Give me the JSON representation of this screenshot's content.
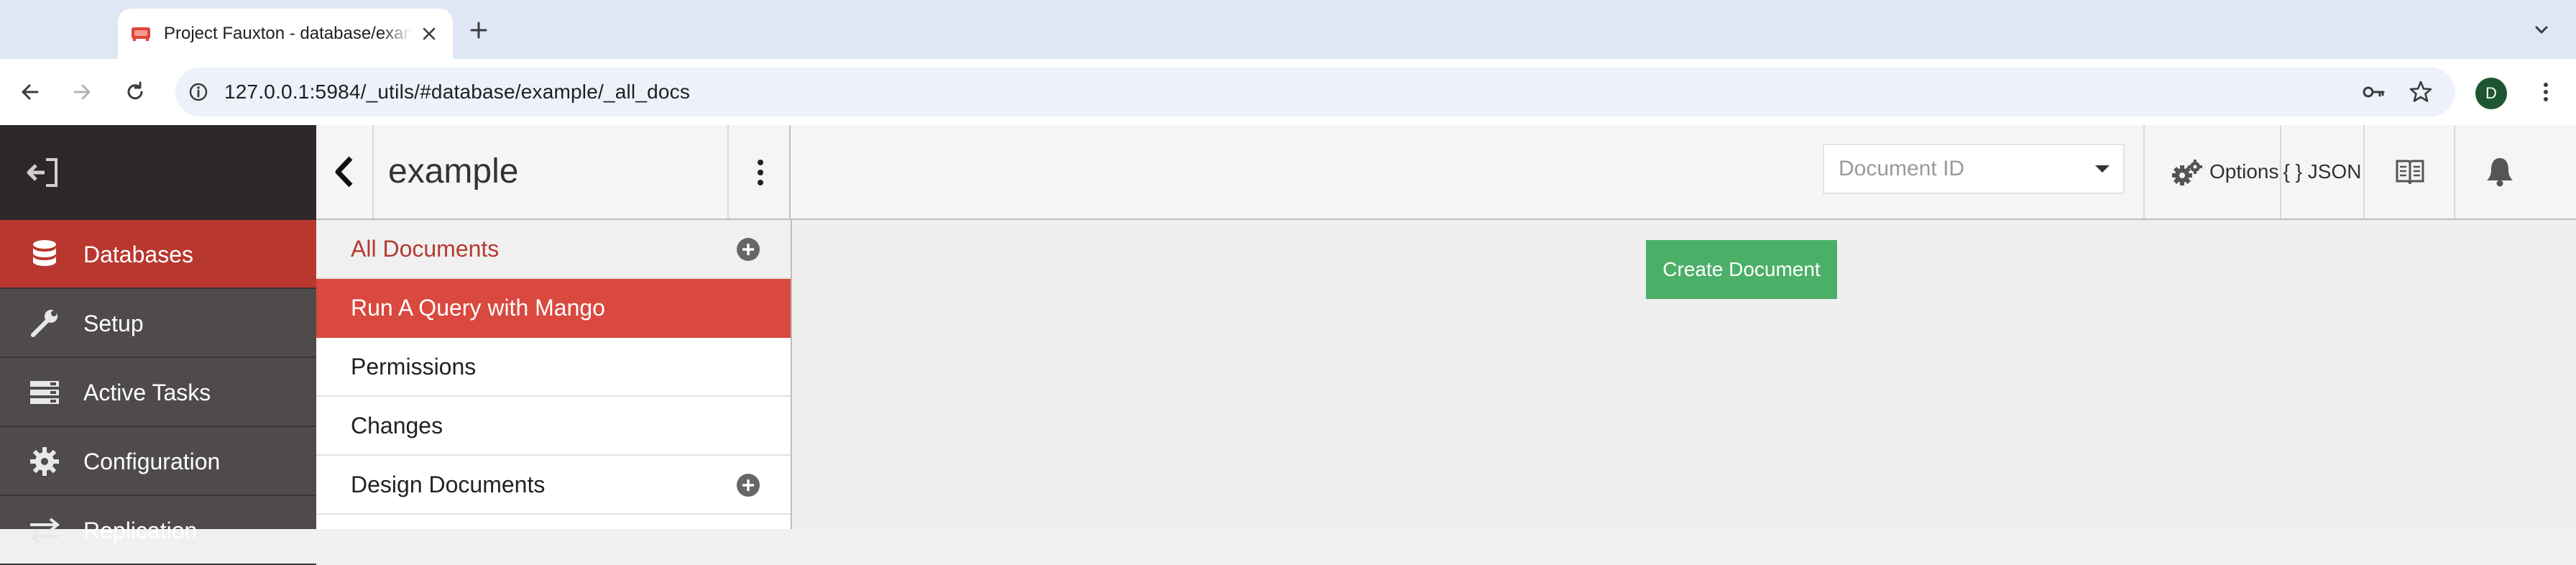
{
  "browser": {
    "tab_title": "Project Fauxton - database/example/_all_docs",
    "url": "127.0.0.1:5984/_utils/#database/example/_all_docs",
    "profile_initial": "D"
  },
  "sidebar": {
    "items": [
      {
        "label": "Databases",
        "icon": "database-icon",
        "active": true
      },
      {
        "label": "Setup",
        "icon": "wrench-icon"
      },
      {
        "label": "Active Tasks",
        "icon": "tasks-icon"
      },
      {
        "label": "Configuration",
        "icon": "gear-icon"
      },
      {
        "label": "Replication",
        "icon": "replication-icon"
      }
    ]
  },
  "header": {
    "db_name": "example",
    "doc_id_placeholder": "Document ID",
    "options_label": "Options",
    "json_label": "{ } JSON"
  },
  "subnav": {
    "items": [
      {
        "label": "All Documents",
        "state": "selected",
        "add_button": true
      },
      {
        "label": "Run A Query with Mango",
        "state": "highlight"
      },
      {
        "label": "Permissions"
      },
      {
        "label": "Changes"
      },
      {
        "label": "Design Documents",
        "add_button": true
      }
    ]
  },
  "content": {
    "create_document_label": "Create Document"
  },
  "colors": {
    "accent_red": "#b8382f",
    "highlight_red": "#d9493f",
    "create_green": "#4caf68",
    "sidebar_bg": "#4f4b4b",
    "sidebar_brand_bg": "#2e2727"
  }
}
